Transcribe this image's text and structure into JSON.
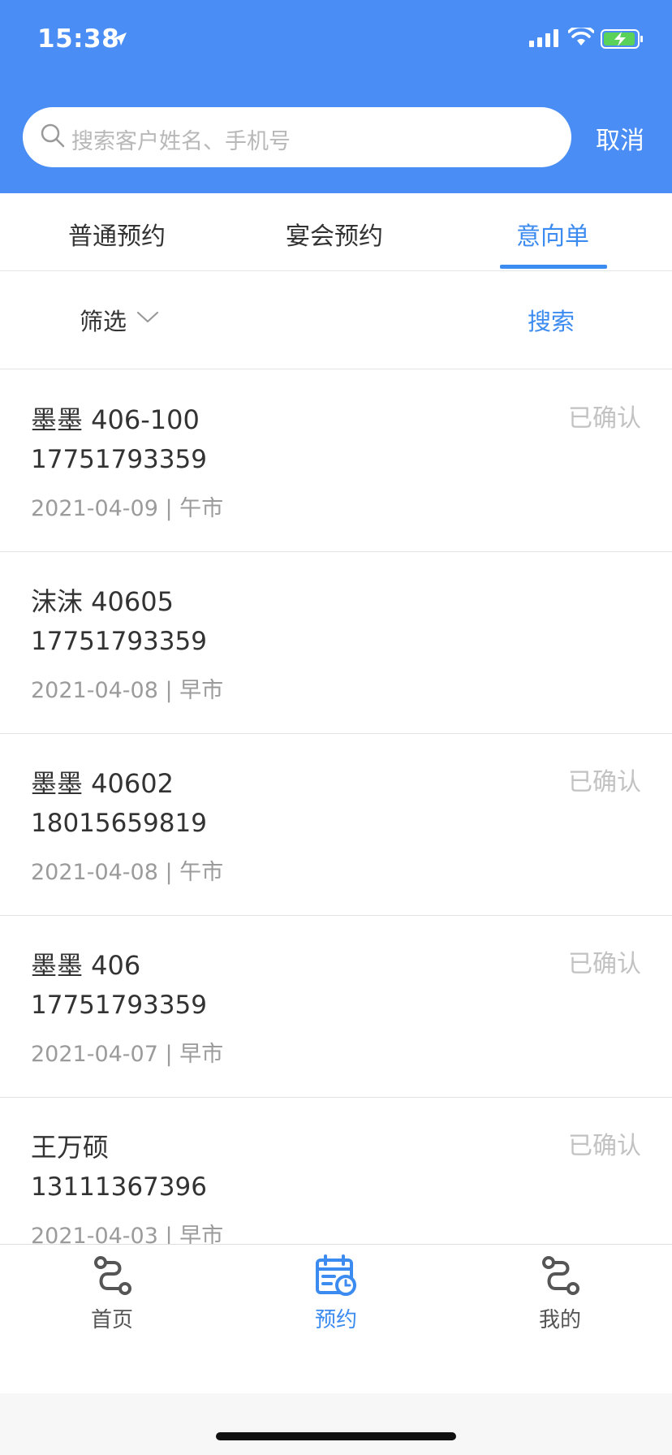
{
  "status_bar": {
    "time": "15:38"
  },
  "search": {
    "placeholder": "搜索客户姓名、手机号",
    "cancel_label": "取消"
  },
  "tabs": [
    {
      "label": "普通预约",
      "active": false
    },
    {
      "label": "宴会预约",
      "active": false
    },
    {
      "label": "意向单",
      "active": true
    }
  ],
  "filter": {
    "label": "筛选",
    "search_label": "搜索"
  },
  "list": [
    {
      "name": "墨墨 406-100",
      "phone": "17751793359",
      "meta": "2021-04-09 | 午市",
      "status": "已确认"
    },
    {
      "name": "沫沫 40605",
      "phone": "17751793359",
      "meta": "2021-04-08 | 早市",
      "status": ""
    },
    {
      "name": "墨墨 40602",
      "phone": "18015659819",
      "meta": "2021-04-08 | 午市",
      "status": "已确认"
    },
    {
      "name": "墨墨 406",
      "phone": "17751793359",
      "meta": "2021-04-07 | 早市",
      "status": "已确认"
    },
    {
      "name": "王万硕",
      "phone": "13111367396",
      "meta": "2021-04-03 | 早市",
      "status": "已确认"
    }
  ],
  "bottom_nav": [
    {
      "label": "首页",
      "icon": "route-icon",
      "active": false
    },
    {
      "label": "预约",
      "icon": "calendar-clock-icon",
      "active": true
    },
    {
      "label": "我的",
      "icon": "route-icon",
      "active": false
    }
  ],
  "colors": {
    "header": "#4a8ef5",
    "accent": "#3c8bf0",
    "status_confirmed": "#c2c2c2"
  }
}
